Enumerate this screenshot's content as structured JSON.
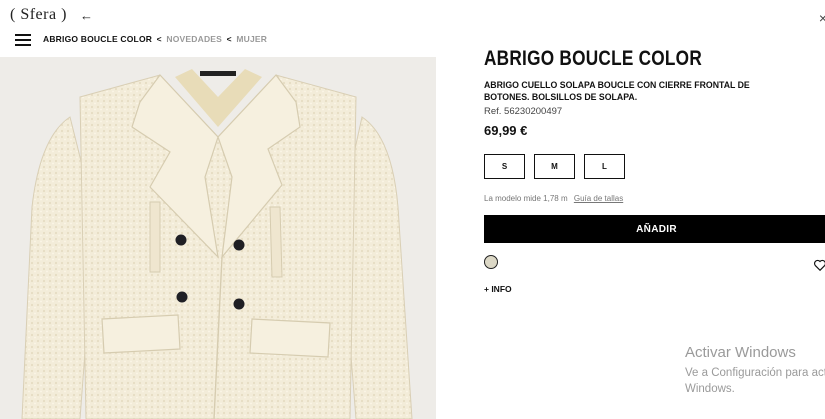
{
  "header": {
    "logo_text": "( Sfera )",
    "back_icon": "arrow-left-icon",
    "close_icon": "close-icon",
    "menu_icon": "hamburger-menu-icon"
  },
  "breadcrumb": {
    "current": "ABRIGO BOUCLE COLOR",
    "separator": "<",
    "links": [
      "NOVEDADES",
      "MUJER"
    ]
  },
  "product": {
    "title": "ABRIGO BOUCLE COLOR",
    "description": "ABRIGO CUELLO SOLAPA BOUCLE CON CIERRE FRONTAL DE BOTONES. BOLSILLOS DE SOLAPA.",
    "ref": "Ref. 56230200497",
    "price": "69,99 €",
    "sizes": [
      "S",
      "M",
      "L"
    ],
    "model_info": "La modelo mide 1,78 m",
    "size_guide_link": "Guía de tallas",
    "add_button": "AÑADIR",
    "info_link": "+ INFO",
    "color_swatch": "#dcd8c6",
    "favorite_icon": "heart-icon"
  },
  "watermark": {
    "title": "Activar Windows",
    "subtitle": "Ve a Configuración para activar",
    "subtitle2": "Windows."
  },
  "colors": {
    "coat": "#f3ecd9",
    "background": "#eeece8",
    "accent": "#000000"
  }
}
